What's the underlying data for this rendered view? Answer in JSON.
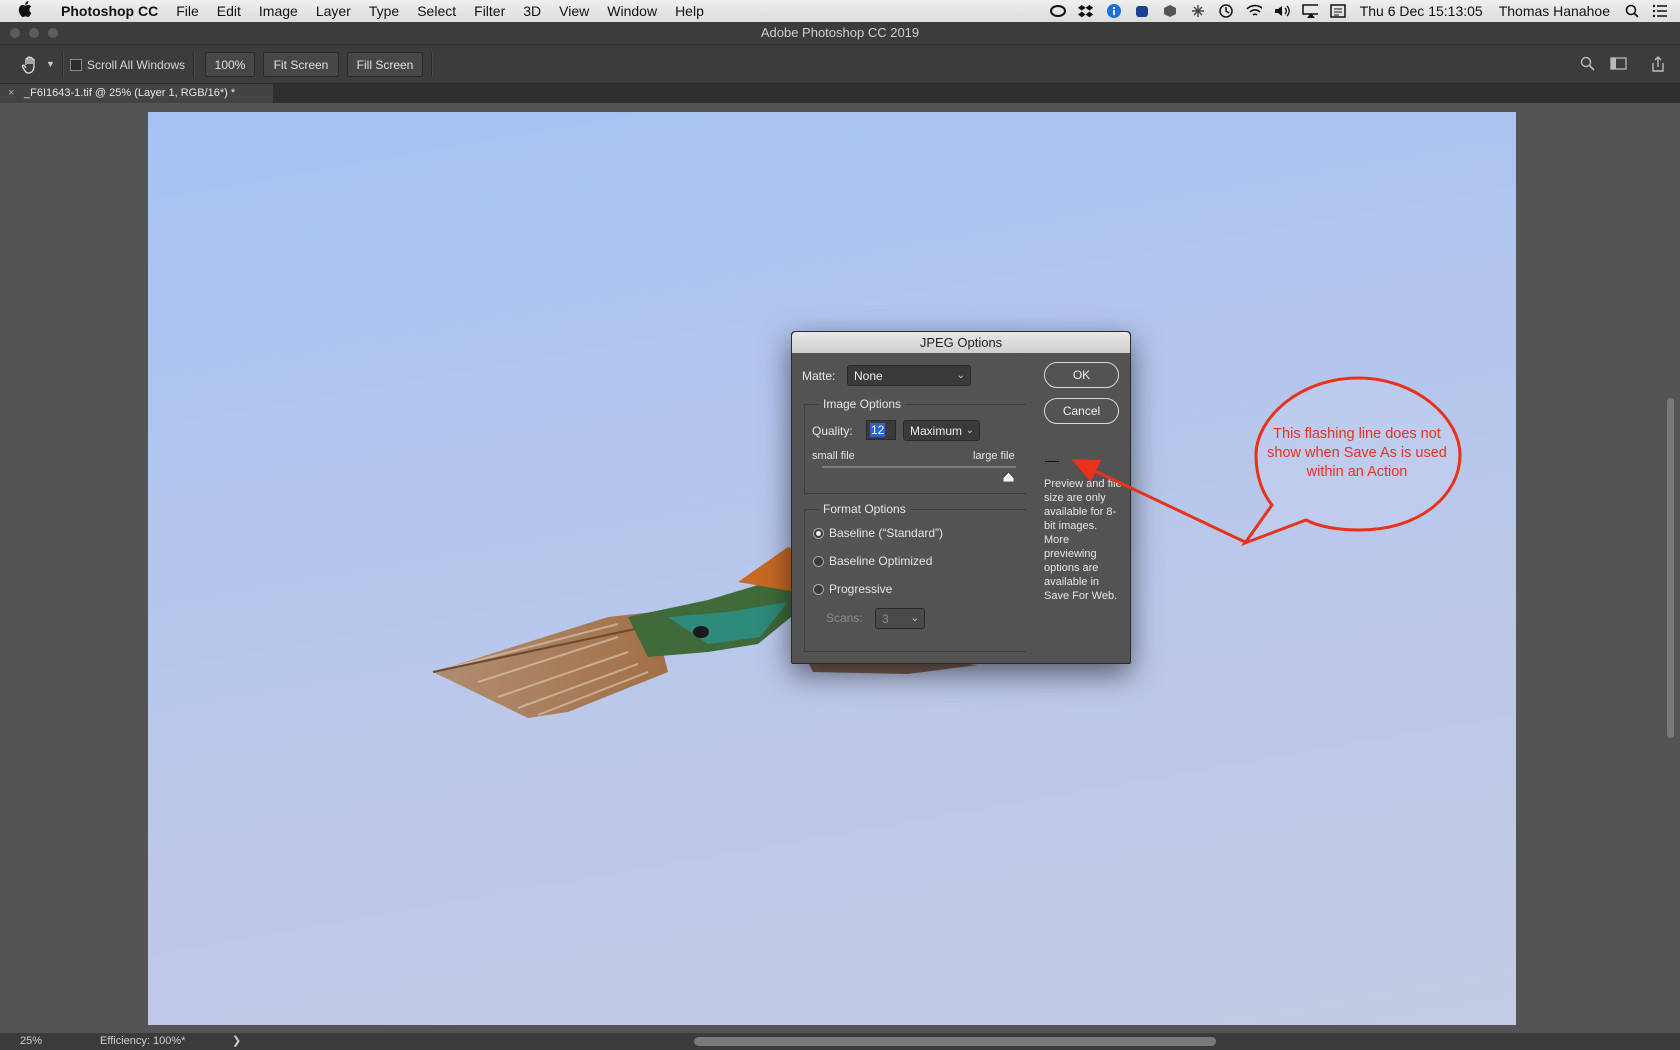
{
  "menubar": {
    "app_name": "Photoshop CC",
    "items": [
      "File",
      "Edit",
      "Image",
      "Layer",
      "Type",
      "Select",
      "Filter",
      "3D",
      "View",
      "Window",
      "Help"
    ],
    "status_icons": [
      "creative-cloud-icon",
      "dropbox-icon",
      "info-icon",
      "app-icon",
      "cube-icon",
      "accessibility-icon",
      "time-machine-icon",
      "wifi-icon",
      "volume-icon",
      "airplay-icon",
      "calendar-icon"
    ],
    "datetime": "Thu 6 Dec  15:13:05",
    "user": "Thomas Hanahoe"
  },
  "window": {
    "title": "Adobe Photoshop CC 2019"
  },
  "options_bar": {
    "scroll_all_label": "Scroll All Windows",
    "zoom_100_label": "100%",
    "fit_screen_label": "Fit Screen",
    "fill_screen_label": "Fill Screen"
  },
  "document_tab": {
    "title": "_F6I1643-1.tif @ 25% (Layer 1, RGB/16*) *"
  },
  "status_bar": {
    "zoom": "25%",
    "efficiency": "Efficiency: 100%*",
    "arrow": "❯"
  },
  "dialog": {
    "title": "JPEG Options",
    "matte_label": "Matte:",
    "matte_value": "None",
    "ok_label": "OK",
    "cancel_label": "Cancel",
    "image_options": {
      "legend": "Image Options",
      "quality_label": "Quality:",
      "quality_value": "12",
      "quality_preset": "Maximum",
      "small_label": "small file",
      "large_label": "large file",
      "slider_level": 0.96
    },
    "format_options": {
      "legend": "Format Options",
      "options": [
        "Baseline (“Standard”)",
        "Baseline Optimized",
        "Progressive"
      ],
      "selected": 0,
      "scans_label": "Scans:",
      "scans_value": "3"
    },
    "preview_note": "Preview and file size are only available for 8-bit images. More previewing options are available in Save For Web."
  },
  "callout": {
    "text": "This flashing line does not show when Save As is used within an Action",
    "color": "#e8321c"
  }
}
